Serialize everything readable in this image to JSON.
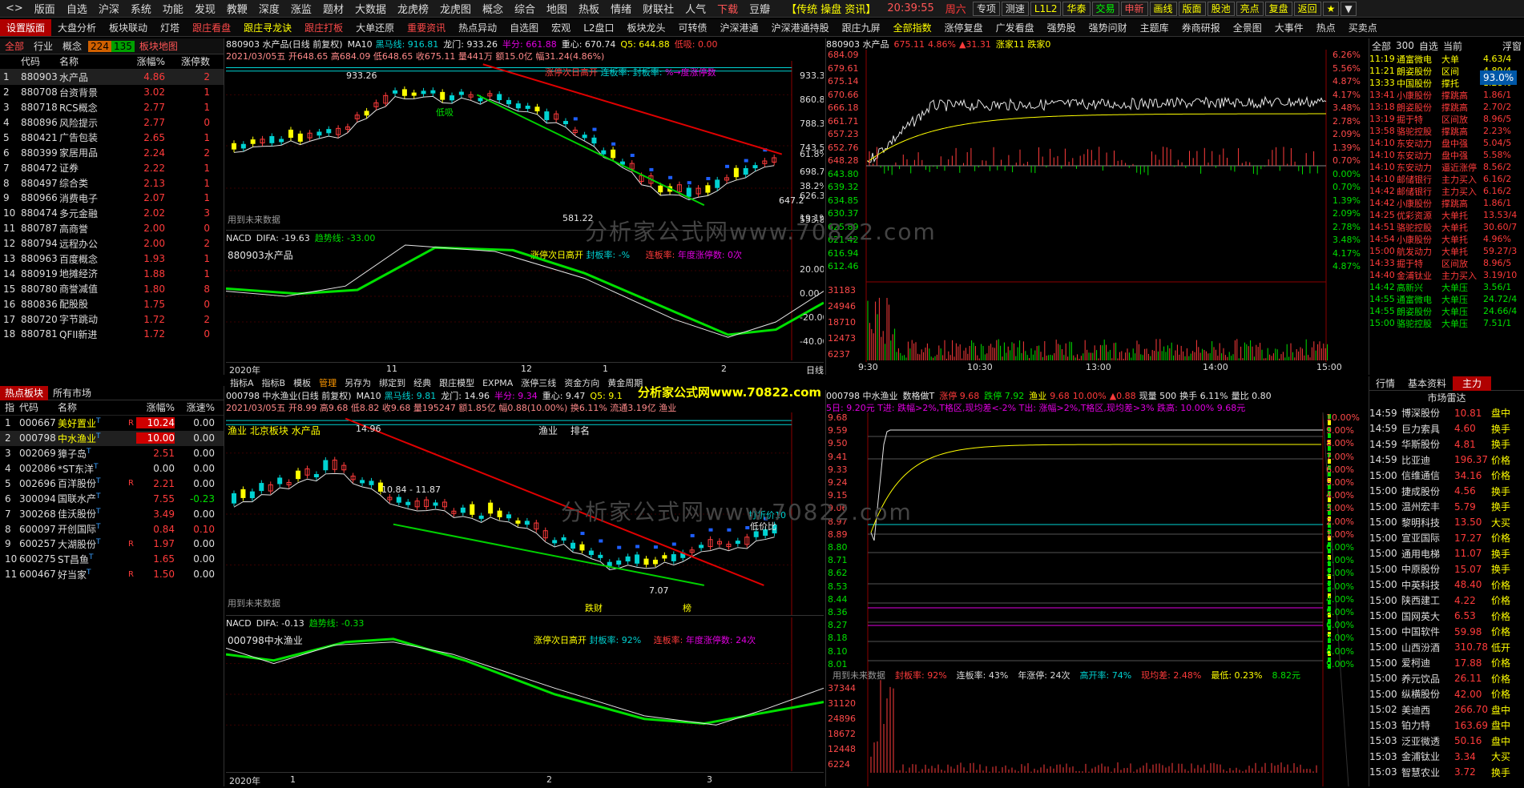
{
  "topbar": {
    "menus": [
      "版面",
      "自选",
      "沪深",
      "系统",
      "功能",
      "发现",
      "教鞭",
      "深度",
      "涨监",
      "题材",
      "大数据",
      "龙虎榜",
      "龙虎图",
      "概念",
      "综合",
      "地图",
      "热板",
      "情绪",
      "财联社",
      "人气",
      "下载",
      "豆瓣"
    ],
    "right_text": "【传统  操盘  资讯】",
    "time": "20:39:55",
    "weekday": "周六",
    "buttons": [
      "专项",
      "测速",
      "L1L2",
      "华泰",
      "交易",
      "申新",
      "画线",
      "版面",
      "股池",
      "亮点",
      "复盘",
      "返回",
      "★",
      "▼"
    ]
  },
  "navbar": {
    "items": [
      "设置版面",
      "大盘分析",
      "板块联动",
      "灯塔",
      "跟庄看盘",
      "跟庄寻龙诀",
      "跟庄打板",
      "大单还原",
      "重要资讯",
      "热点异动",
      "自选图",
      "宏观",
      "L2盘口",
      "板块龙头",
      "可转债",
      "沪深港通",
      "沪深港通持股",
      "跟庄九屏",
      "全部指数",
      "涨停复盘",
      "广发看盘",
      "强势股",
      "强势问财",
      "主题库",
      "券商研报",
      "全景图",
      "大事件",
      "热点",
      "买卖点"
    ]
  },
  "sector_list": {
    "tabs": [
      "全部",
      "行业",
      "概念"
    ],
    "up_count": "224",
    "down_count": "135",
    "map_label": "板块地图",
    "headers": [
      "",
      "代码",
      "名称",
      "涨幅%",
      "涨停数"
    ],
    "rows": [
      [
        "1",
        "880903",
        "水产品",
        "4.86",
        "2"
      ],
      [
        "2",
        "880708",
        "台资背景",
        "3.02",
        "1"
      ],
      [
        "3",
        "880718",
        "RCS概念",
        "2.77",
        "1"
      ],
      [
        "4",
        "880896",
        "风险提示",
        "2.77",
        "0"
      ],
      [
        "5",
        "880421",
        "广告包装",
        "2.65",
        "1"
      ],
      [
        "6",
        "880399",
        "家居用品",
        "2.24",
        "2"
      ],
      [
        "7",
        "880472",
        "证券",
        "2.22",
        "1"
      ],
      [
        "8",
        "880497",
        "综合类",
        "2.13",
        "1"
      ],
      [
        "9",
        "880966",
        "消费电子",
        "2.07",
        "1"
      ],
      [
        "10",
        "880474",
        "多元金融",
        "2.02",
        "3"
      ],
      [
        "11",
        "880787",
        "高商誉",
        "2.00",
        "0"
      ],
      [
        "12",
        "880794",
        "远程办公",
        "2.00",
        "2"
      ],
      [
        "13",
        "880963",
        "百度概念",
        "1.93",
        "1"
      ],
      [
        "14",
        "880919",
        "地摊经济",
        "1.88",
        "1"
      ],
      [
        "15",
        "880780",
        "商誉减值",
        "1.80",
        "8"
      ],
      [
        "16",
        "880836",
        "配股股",
        "1.75",
        "0"
      ],
      [
        "17",
        "880720",
        "字节跳动",
        "1.72",
        "2"
      ],
      [
        "18",
        "880781",
        "QFII新进",
        "1.72",
        "0"
      ]
    ]
  },
  "stock_list": {
    "tabs": [
      "热点板块",
      "所有市场"
    ],
    "headers": [
      "指",
      "代码",
      "名称",
      "涨幅%",
      "涨速%"
    ],
    "rows": [
      [
        "1",
        "000667",
        "美好置业",
        "T",
        "R",
        "10.24",
        "0.00"
      ],
      [
        "2",
        "000798",
        "中水渔业",
        "T",
        "",
        "10.00",
        "0.00"
      ],
      [
        "3",
        "002069",
        "獐子岛",
        "T",
        "",
        "2.51",
        "0.00"
      ],
      [
        "4",
        "002086",
        "*ST东洋",
        "T",
        "",
        "0.00",
        "0.00"
      ],
      [
        "5",
        "002696",
        "百洋股份",
        "T",
        "R",
        "2.21",
        "0.00"
      ],
      [
        "6",
        "300094",
        "国联水产",
        "T",
        "",
        "7.55",
        "-0.23"
      ],
      [
        "7",
        "300268",
        "佳沃股份",
        "T",
        "",
        "3.49",
        "0.00"
      ],
      [
        "8",
        "600097",
        "开创国际",
        "T",
        "",
        "0.84",
        "0.10"
      ],
      [
        "9",
        "600257",
        "大湖股份",
        "T",
        "R",
        "1.97",
        "0.00"
      ],
      [
        "10",
        "600275",
        "ST昌鱼",
        "T",
        "",
        "1.65",
        "0.00"
      ],
      [
        "11",
        "600467",
        "好当家",
        "T",
        "R",
        "1.50",
        "0.00"
      ]
    ]
  },
  "chart_top": {
    "header": "880903 水产品(日线 前复权)",
    "ma_label": "MA10",
    "ma_sub": "黑马线: 916.81",
    "lm": "龙门: 933.26",
    "half": "半分: 661.88",
    "center": "重心: 670.74",
    "q5": "Q5: 644.88",
    "low": "低吸: 0.00",
    "ohlc": "2021/03/05五 开648.65 高684.09 低648.65 收675.11 量441万 额15.0亿 幅31.24(4.86%)",
    "yticks": [
      "933.3",
      "860.8",
      "788.3",
      "743.5",
      "698.7",
      "626.3",
      "553.8"
    ],
    "pct_ticks": [
      "61.8%",
      "38.2%",
      "19.1%"
    ],
    "annot_high": "933.26",
    "annot_low": "581.22",
    "annot_mid": "647.2",
    "future_note": "用到未来数据",
    "strip_labels": [
      "涨停次日高开",
      "连板率:",
      "封板率:",
      "%→度涨停数"
    ],
    "low_label": "低吸"
  },
  "macd_top": {
    "title": "NACD",
    "difa": "DIFA: -19.63",
    "trend": "趋势线: -33.00",
    "name": "880903水产品",
    "info1": "涨停次日高开",
    "info2": "封板率: -%",
    "info3": "连板率:",
    "info4": "年度涨停数: 0次",
    "yticks": [
      "20.00",
      "0.00",
      "-20.00",
      "-40.00"
    ]
  },
  "xaxis_top": {
    "labels": [
      "2020年",
      "11",
      "12",
      "1",
      "2",
      "3"
    ],
    "unit": "日线"
  },
  "chart_bottom": {
    "toolbar": [
      "指标A",
      "指标B",
      "模板",
      "管理",
      "另存为",
      "绑定到",
      "经典",
      "跟庄模型",
      "EXPMA",
      "涨停三线",
      "资金方向",
      "黄金周期"
    ],
    "header": "000798 中水渔业(日线 前复权)",
    "ma_label": "MA10",
    "ma_sub": "黑马线: 9.81",
    "lm": "龙门: 14.96",
    "half": "半分: 9.34",
    "center": "重心: 9.47",
    "q5": "Q5: 9.1",
    "ohlc": "2021/03/05五 开8.99 高9.68 低8.82 收9.68 量195247 额1.85亿 幅0.88(10.00%) 换6.11% 流通3.19亿 渔业",
    "tags": [
      "渔业",
      "北京板块",
      "水产品"
    ],
    "rank_label": "渔业",
    "rank": "排名",
    "annot_high": "14.96",
    "annot_mid": "10.84 - 11.87",
    "annot_low": "7.07",
    "future_note": "用到未来数据",
    "labels_right": [
      "打折价10",
      "低价比"
    ],
    "tag_a": "跌财",
    "tag_b": "榜"
  },
  "macd_bottom": {
    "title": "NACD",
    "difa": "DIFA: -0.13",
    "trend": "趋势线: -0.33",
    "name": "000798中水渔业",
    "info1": "涨停次日高开",
    "info2": "封板率: 92%",
    "info3": "连板率:",
    "info4": "年度涨停数: 24次"
  },
  "xaxis_bottom": {
    "labels": [
      "2020年",
      "1",
      "2",
      "3"
    ]
  },
  "intraday_top": {
    "header": "880903 水产品",
    "price": "675.11",
    "pct": "4.86%",
    "chg": "▲31.31",
    "up_down": "涨家11 跌家0",
    "yleft": [
      "684.09",
      "679.61",
      "675.14",
      "670.66",
      "666.18",
      "661.71",
      "657.23",
      "652.76",
      "648.28",
      "643.80",
      "639.32",
      "634.85",
      "630.37",
      "625.89",
      "621.42",
      "616.94",
      "612.46"
    ],
    "yright": [
      "6.26%",
      "5.56%",
      "4.87%",
      "4.17%",
      "3.48%",
      "2.78%",
      "2.09%",
      "1.39%",
      "0.70%",
      "0.00%",
      "0.70%",
      "1.39%",
      "2.09%",
      "2.78%",
      "3.48%",
      "4.17%",
      "4.87%"
    ],
    "vol_ticks": [
      "31183",
      "24946",
      "18710",
      "12473",
      "6237"
    ],
    "times": [
      "9:30",
      "10:30",
      "13:00",
      "14:00",
      "15:00"
    ]
  },
  "intraday_bottom": {
    "header": "000798 中水渔业",
    "tag_t": "数格做T",
    "up": "涨停 9.68",
    "down": "跌停 7.92",
    "cat": "渔业",
    "price": "9.68",
    "pct": "10.00%",
    "chg": "▲0.88",
    "vol": "现量 500",
    "turn": "换手 6.11%",
    "ratio": "量比 0.80",
    "line2": "5日: 9.20元 T进: 跌幅>2%,T格区,现均差<-2%  T出: 涨幅>2%,T格区,现均差>3%  跌高: 10.00% 9.68元",
    "yleft": [
      "9.68",
      "9.59",
      "9.50",
      "9.41",
      "9.33",
      "9.24",
      "9.15",
      "9.06",
      "8.97",
      "8.89",
      "8.80",
      "8.71",
      "8.62",
      "8.53",
      "8.44",
      "8.36",
      "8.27",
      "8.18",
      "8.10",
      "8.01"
    ],
    "yright": [
      "10.00%",
      "9.00%",
      "8.00%",
      "7.00%",
      "6.00%",
      "5.00%",
      "4.00%",
      "3.00%",
      "2.00%",
      "1.00%",
      "0.00%",
      "1.00%",
      "2.00%",
      "3.00%",
      "4.00%",
      "5.00%",
      "6.00%",
      "7.00%",
      "8.00%",
      "9.00%"
    ],
    "t_labels": [
      "-T1",
      "+T1",
      "+T2"
    ],
    "stats": [
      "用到未来数据",
      "封板率: 92%",
      "连板率: 43%",
      "年涨停: 24次",
      "高开率: 74%",
      "现均差: 2.48%",
      "最低: 0.23%",
      "8.82元"
    ],
    "vol_ticks": [
      "37344",
      "31120",
      "24896",
      "18672",
      "12448",
      "6224"
    ]
  },
  "right_top": {
    "header": [
      "全部",
      "300",
      "自选",
      "当前"
    ],
    "extra": "浮窗",
    "pct_box": "93.0%",
    "rows": [
      [
        "11:19",
        "通富微电",
        "大单",
        "4.63/4"
      ],
      [
        "11:21",
        "朗姿股份",
        "区间",
        "4.89/4"
      ],
      [
        "13:33",
        "中国股份",
        "撑托",
        "1.28%"
      ],
      [
        "13:41",
        "小康股份",
        "撑跳高",
        "1.86/1"
      ],
      [
        "13:18",
        "朗姿股份",
        "撑跳高",
        "2.70/2"
      ],
      [
        "13:19",
        "掘于特",
        "区间放",
        "8.96/5"
      ],
      [
        "13:58",
        "骆驼控股",
        "撑跳高",
        "2.23%"
      ],
      [
        "14:10",
        "东安动力",
        "盘中强",
        "5.04/5"
      ],
      [
        "14:10",
        "东安动力",
        "盘中强",
        "5.58%"
      ],
      [
        "14:10",
        "东安动力",
        "逼近涨停",
        "8.56/2"
      ],
      [
        "14:10",
        "邮储银行",
        "主力买入",
        "6.16/2"
      ],
      [
        "14:42",
        "邮储银行",
        "主力买入",
        "6.16/2"
      ],
      [
        "14:42",
        "小康股份",
        "撑跳高",
        "1.86/1"
      ],
      [
        "14:25",
        "优彩资源",
        "大单托",
        "13.53/4"
      ],
      [
        "14:51",
        "骆驼控股",
        "大单托",
        "30.60/7"
      ],
      [
        "14:54",
        "小康股份",
        "大单托",
        "4.96%"
      ],
      [
        "15:00",
        "航发动力",
        "大单托",
        "59.27/3"
      ],
      [
        "14:33",
        "掘于特",
        "区间放",
        "8.96/5"
      ],
      [
        "14:40",
        "金浦钛业",
        "主力买入",
        "3.19/10"
      ],
      [
        "14:42",
        "高新兴",
        "大单压",
        "3.56/1"
      ],
      [
        "14:55",
        "通富微电",
        "大单压",
        "24.72/4"
      ],
      [
        "14:55",
        "朗姿股份",
        "大单压",
        "24.66/4"
      ],
      [
        "15:00",
        "骆驼控股",
        "大单压",
        "7.51/1"
      ]
    ]
  },
  "right_bottom": {
    "tabs": [
      "行情",
      "基本资料",
      "主力"
    ],
    "title": "市场雷达",
    "rows": [
      [
        "14:59",
        "博深股份",
        "10.81",
        "盘中"
      ],
      [
        "14:59",
        "巨力索具",
        "4.60",
        "换手"
      ],
      [
        "14:59",
        "华斯股份",
        "4.81",
        "换手"
      ],
      [
        "14:59",
        "比亚迪",
        "196.37",
        "价格"
      ],
      [
        "15:00",
        "信维通信",
        "34.16",
        "价格"
      ],
      [
        "15:00",
        "捷成股份",
        "4.56",
        "换手"
      ],
      [
        "15:00",
        "温州宏丰",
        "5.79",
        "换手"
      ],
      [
        "15:00",
        "黎明科技",
        "13.50",
        "大买"
      ],
      [
        "15:00",
        "宣亚国际",
        "17.27",
        "价格"
      ],
      [
        "15:00",
        "通用电梯",
        "11.07",
        "换手"
      ],
      [
        "15:00",
        "中原股份",
        "15.07",
        "换手"
      ],
      [
        "15:00",
        "中英科技",
        "48.40",
        "价格"
      ],
      [
        "15:00",
        "陕西建工",
        "4.22",
        "价格"
      ],
      [
        "15:00",
        "国网英大",
        "6.53",
        "价格"
      ],
      [
        "15:00",
        "中国软件",
        "59.98",
        "价格"
      ],
      [
        "15:00",
        "山西汾酒",
        "310.78",
        "低开"
      ],
      [
        "15:00",
        "爱柯迪",
        "17.88",
        "价格"
      ],
      [
        "15:00",
        "养元饮品",
        "26.11",
        "价格"
      ],
      [
        "15:00",
        "纵横股份",
        "42.00",
        "价格"
      ],
      [
        "15:02",
        "美迪西",
        "266.70",
        "盘中"
      ],
      [
        "15:03",
        "铂力特",
        "163.69",
        "盘中"
      ],
      [
        "15:03",
        "泛亚微透",
        "50.16",
        "盘中"
      ],
      [
        "15:03",
        "金浦钛业",
        "3.34",
        "大买"
      ],
      [
        "15:03",
        "智慧农业",
        "3.72",
        "换手"
      ]
    ]
  },
  "watermark": {
    "text": "分析家公式网www.70822.com",
    "top_text": "分析家公式网www.70822.com"
  }
}
